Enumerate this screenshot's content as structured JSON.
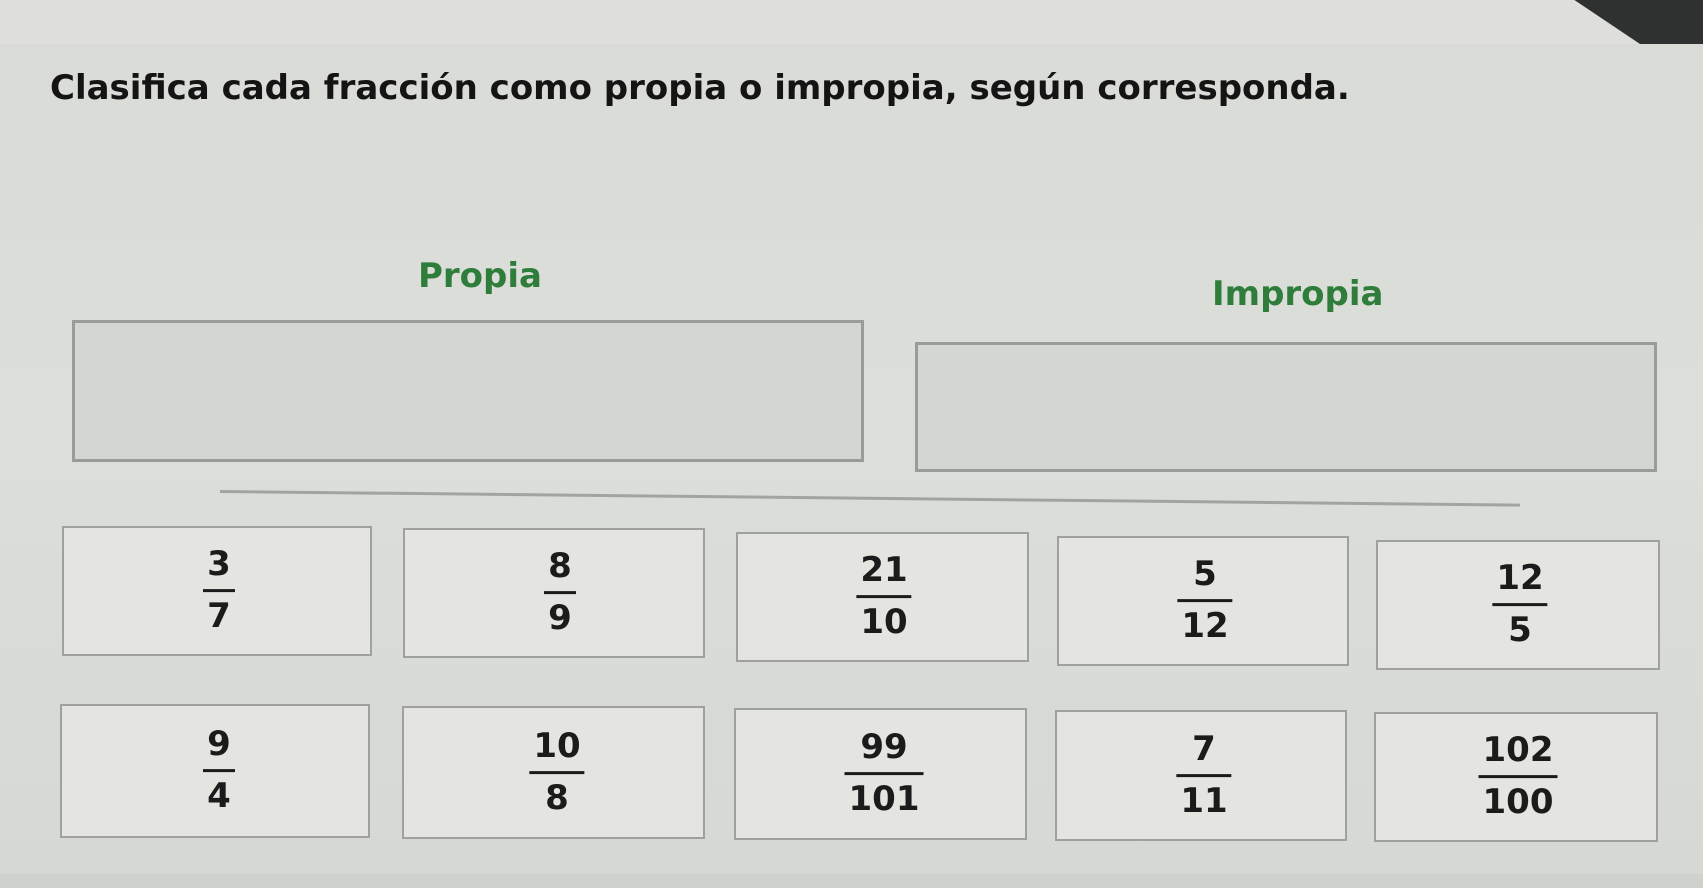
{
  "instruction": "Clasifica cada fracción como propia o impropia, según corresponda.",
  "categories": {
    "propia": "Propia",
    "impropia": "Impropia"
  },
  "fractions": [
    {
      "numerator": "3",
      "denominator": "7"
    },
    {
      "numerator": "8",
      "denominator": "9"
    },
    {
      "numerator": "21",
      "denominator": "10"
    },
    {
      "numerator": "5",
      "denominator": "12"
    },
    {
      "numerator": "12",
      "denominator": "5"
    },
    {
      "numerator": "9",
      "denominator": "4"
    },
    {
      "numerator": "10",
      "denominator": "8"
    },
    {
      "numerator": "99",
      "denominator": "101"
    },
    {
      "numerator": "7",
      "denominator": "11"
    },
    {
      "numerator": "102",
      "denominator": "100"
    }
  ],
  "colors": {
    "category_title": "#2f7d3a",
    "instruction_text": "#141414",
    "card_background": "#e4e5e1",
    "drop_zone_background": "#d4d6d1"
  }
}
